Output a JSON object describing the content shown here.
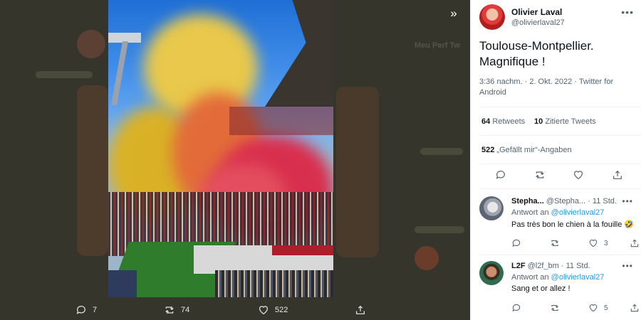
{
  "backdrop_partial_text": {
    "line1": "Meu Perf Tw"
  },
  "media_actions": {
    "replies": "7",
    "retweets": "74",
    "likes": "522"
  },
  "tweet": {
    "author_name": "Olivier Laval",
    "author_handle": "@olivierlaval27",
    "text": "Toulouse-Montpellier. Magnifique !",
    "meta": "3:36 nachm. · 2. Okt. 2022 · Twitter for Android",
    "retweets_count": "64",
    "retweets_label": "Retweets",
    "quotes_count": "10",
    "quotes_label": "Zitierte Tweets",
    "likes_count": "522",
    "likes_label": "„Gefällt mir“-Angaben"
  },
  "replies": [
    {
      "name": "Stepha...",
      "handle": "@Stepha...",
      "time": "· 11 Std.",
      "reply_prefix": "Antwort an",
      "reply_to": "@olivierlaval27",
      "text": "Pas très bon le chien à la fouille 🤣",
      "likes": "3"
    },
    {
      "name": "L2F",
      "handle": "@l2f_bm",
      "time": "· 11 Std.",
      "reply_prefix": "Antwort an",
      "reply_to": "@olivierlaval27",
      "text": "Sang et or allez !",
      "likes": "5"
    }
  ],
  "icons": {
    "collapse": "double-chevron-right-icon",
    "reply": "reply-icon",
    "retweet": "retweet-icon",
    "like": "heart-icon",
    "share": "share-icon",
    "more": "more-icon"
  },
  "colors": {
    "link": "#1d9bf0",
    "text": "#0f1419",
    "muted": "#536471",
    "panel_bg": "#ffffff",
    "backdrop": "#35352b"
  }
}
